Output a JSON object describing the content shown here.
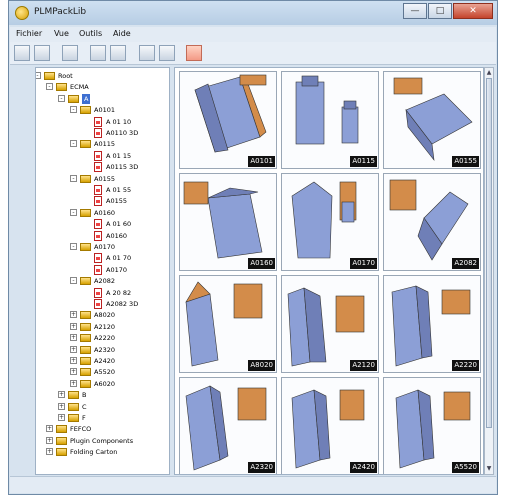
{
  "app": {
    "title": "PLMPackLib"
  },
  "window_controls": {
    "minimize": "—",
    "maximize": "□",
    "close": "✕"
  },
  "menu": [
    "Fichier",
    "Vue",
    "Outils",
    "Aide"
  ],
  "toolbar": {
    "icons": [
      "save-icon",
      "edit-icon",
      "dimension-icon",
      "align-icon",
      "mirror-icon",
      "group-icon",
      "zoom-icon",
      "palette-icon"
    ]
  },
  "tree": {
    "nodes": [
      {
        "label": "Root",
        "level": 0,
        "type": "folder",
        "exp": "-"
      },
      {
        "label": "ECMA",
        "level": 1,
        "type": "folder",
        "exp": "-"
      },
      {
        "label": "A",
        "level": 2,
        "type": "folder",
        "exp": "-",
        "selected": true
      },
      {
        "label": "A0101",
        "level": 3,
        "type": "folder",
        "exp": "-"
      },
      {
        "label": "A 01 10",
        "level": 4,
        "type": "doc"
      },
      {
        "label": "A0110 3D",
        "level": 4,
        "type": "doc"
      },
      {
        "label": "A0115",
        "level": 3,
        "type": "folder",
        "exp": "-"
      },
      {
        "label": "A 01 15",
        "level": 4,
        "type": "doc"
      },
      {
        "label": "A0115 3D",
        "level": 4,
        "type": "doc"
      },
      {
        "label": "A0155",
        "level": 3,
        "type": "folder",
        "exp": "-"
      },
      {
        "label": "A 01 55",
        "level": 4,
        "type": "doc"
      },
      {
        "label": "A0155",
        "level": 4,
        "type": "doc"
      },
      {
        "label": "A0160",
        "level": 3,
        "type": "folder",
        "exp": "-"
      },
      {
        "label": "A 01 60",
        "level": 4,
        "type": "doc"
      },
      {
        "label": "A0160",
        "level": 4,
        "type": "doc"
      },
      {
        "label": "A0170",
        "level": 3,
        "type": "folder",
        "exp": "-"
      },
      {
        "label": "A 01 70",
        "level": 4,
        "type": "doc"
      },
      {
        "label": "A0170",
        "level": 4,
        "type": "doc"
      },
      {
        "label": "A2082",
        "level": 3,
        "type": "folder",
        "exp": "-"
      },
      {
        "label": "A 20 82",
        "level": 4,
        "type": "doc"
      },
      {
        "label": "A2082 3D",
        "level": 4,
        "type": "doc"
      },
      {
        "label": "A8020",
        "level": 3,
        "type": "folder",
        "exp": "+"
      },
      {
        "label": "A2120",
        "level": 3,
        "type": "folder",
        "exp": "+"
      },
      {
        "label": "A2220",
        "level": 3,
        "type": "folder",
        "exp": "+"
      },
      {
        "label": "A2320",
        "level": 3,
        "type": "folder",
        "exp": "+"
      },
      {
        "label": "A2420",
        "level": 3,
        "type": "folder",
        "exp": "+"
      },
      {
        "label": "A5520",
        "level": 3,
        "type": "folder",
        "exp": "+"
      },
      {
        "label": "A6020",
        "level": 3,
        "type": "folder",
        "exp": "+"
      },
      {
        "label": "B",
        "level": 2,
        "type": "folder",
        "exp": "+"
      },
      {
        "label": "C",
        "level": 2,
        "type": "folder",
        "exp": "+"
      },
      {
        "label": "F",
        "level": 2,
        "type": "folder",
        "exp": "+"
      },
      {
        "label": "FEFCO",
        "level": 1,
        "type": "folder",
        "exp": "+"
      },
      {
        "label": "Plugin Components",
        "level": 1,
        "type": "folder",
        "exp": "+"
      },
      {
        "label": "Folding Carton",
        "level": 1,
        "type": "folder",
        "exp": "+"
      }
    ]
  },
  "thumbnails": [
    {
      "label": "A0101",
      "style": 1
    },
    {
      "label": "A0115",
      "style": 2
    },
    {
      "label": "A0155",
      "style": 3
    },
    {
      "label": "A0160",
      "style": 4
    },
    {
      "label": "A0170",
      "style": 5
    },
    {
      "label": "A2082",
      "style": 6
    },
    {
      "label": "A8020",
      "style": 7
    },
    {
      "label": "A2120",
      "style": 8
    },
    {
      "label": "A2220",
      "style": 9
    },
    {
      "label": "A2320",
      "style": 10
    },
    {
      "label": "A2420",
      "style": 11
    },
    {
      "label": "A5520",
      "style": 12
    }
  ],
  "colors": {
    "box": "#8c9fd6",
    "box_dark": "#6f7fb7",
    "flap": "#d38c4a",
    "flap_dark": "#a7652d",
    "highlight": "#3d6fd1"
  }
}
